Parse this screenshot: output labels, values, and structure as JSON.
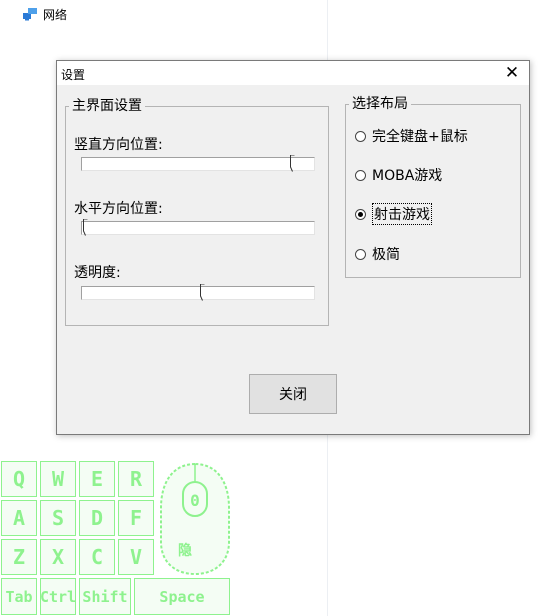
{
  "explorer": {
    "nav_item": "网络"
  },
  "dialog": {
    "title": "设置",
    "close_glyph": "✕",
    "main_group": {
      "title": "主界面设置",
      "sliders": [
        {
          "label": "竖直方向位置:",
          "value": 0.92
        },
        {
          "label": "水平方向位置:",
          "value": 0.0
        },
        {
          "label": "透明度:",
          "value": 0.52
        }
      ]
    },
    "layout_group": {
      "title": "选择布局",
      "options": [
        {
          "label": "完全键盘+鼠标",
          "selected": false
        },
        {
          "label": "MOBA游戏",
          "selected": false
        },
        {
          "label": "射击游戏",
          "selected": true
        },
        {
          "label": "极简",
          "selected": false
        }
      ]
    },
    "ok_button": "关闭"
  },
  "overlay": {
    "color": "#8ef28e",
    "rows": [
      [
        "Q",
        "W",
        "E",
        "R"
      ],
      [
        "A",
        "S",
        "D",
        "F"
      ],
      [
        "Z",
        "X",
        "C",
        "V"
      ]
    ],
    "bottom": [
      "Tab",
      "Ctrl",
      "Shift",
      "Space"
    ],
    "mouse_button": "0",
    "mouse_label": "隐"
  }
}
